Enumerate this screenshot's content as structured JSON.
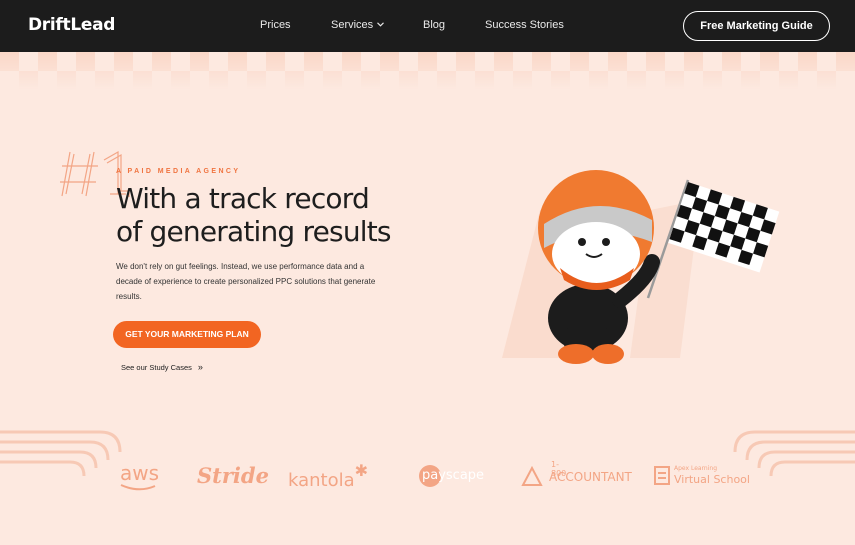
{
  "nav": {
    "logo": "DriftLead",
    "links": [
      "Prices",
      "Services",
      "Blog",
      "Success Stories"
    ],
    "cta": "Free Marketing Guide"
  },
  "hero": {
    "badge": "#1",
    "eyebrow": "A PAID MEDIA AGENCY",
    "headline_line1": "With a track record",
    "headline_line2": "of generating results",
    "description": "We don't rely on gut feelings. Instead, we use performance data and a decade of experience to create personalized PPC solutions that generate results.",
    "cta": "GET YOUR MARKETING PLAN",
    "secondary_link": "See our Study Cases",
    "secondary_icon": "double-chevron-right-icon"
  },
  "logos": {
    "aws": "aws",
    "stride": "Stride",
    "kantola": "kantola",
    "payscape": "payscape",
    "accountant_top": "1-800",
    "accountant_main": "ACCOUNTANT",
    "apex_top": "Apex Learning",
    "apex_main": "Virtual School"
  },
  "colors": {
    "accent": "#f26522",
    "nav_bg": "#1c1c1c",
    "page_bg": "#fde9e0",
    "logo_tint": "#f3a585"
  }
}
